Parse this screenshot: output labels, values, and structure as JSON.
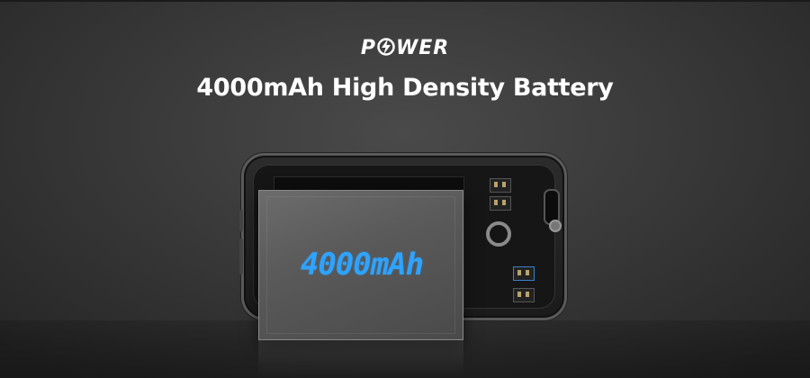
{
  "header": {
    "brand": [
      "P",
      "WER"
    ],
    "headline": "4000mAh High Density Battery"
  },
  "battery": {
    "label": "4000mAh"
  },
  "icons": {
    "brand_o": "lightning-bolt-icon"
  },
  "colors": {
    "battery_text": "#2ea3ff",
    "headline_text": "#ffffff",
    "background": "#3a3a3a"
  }
}
